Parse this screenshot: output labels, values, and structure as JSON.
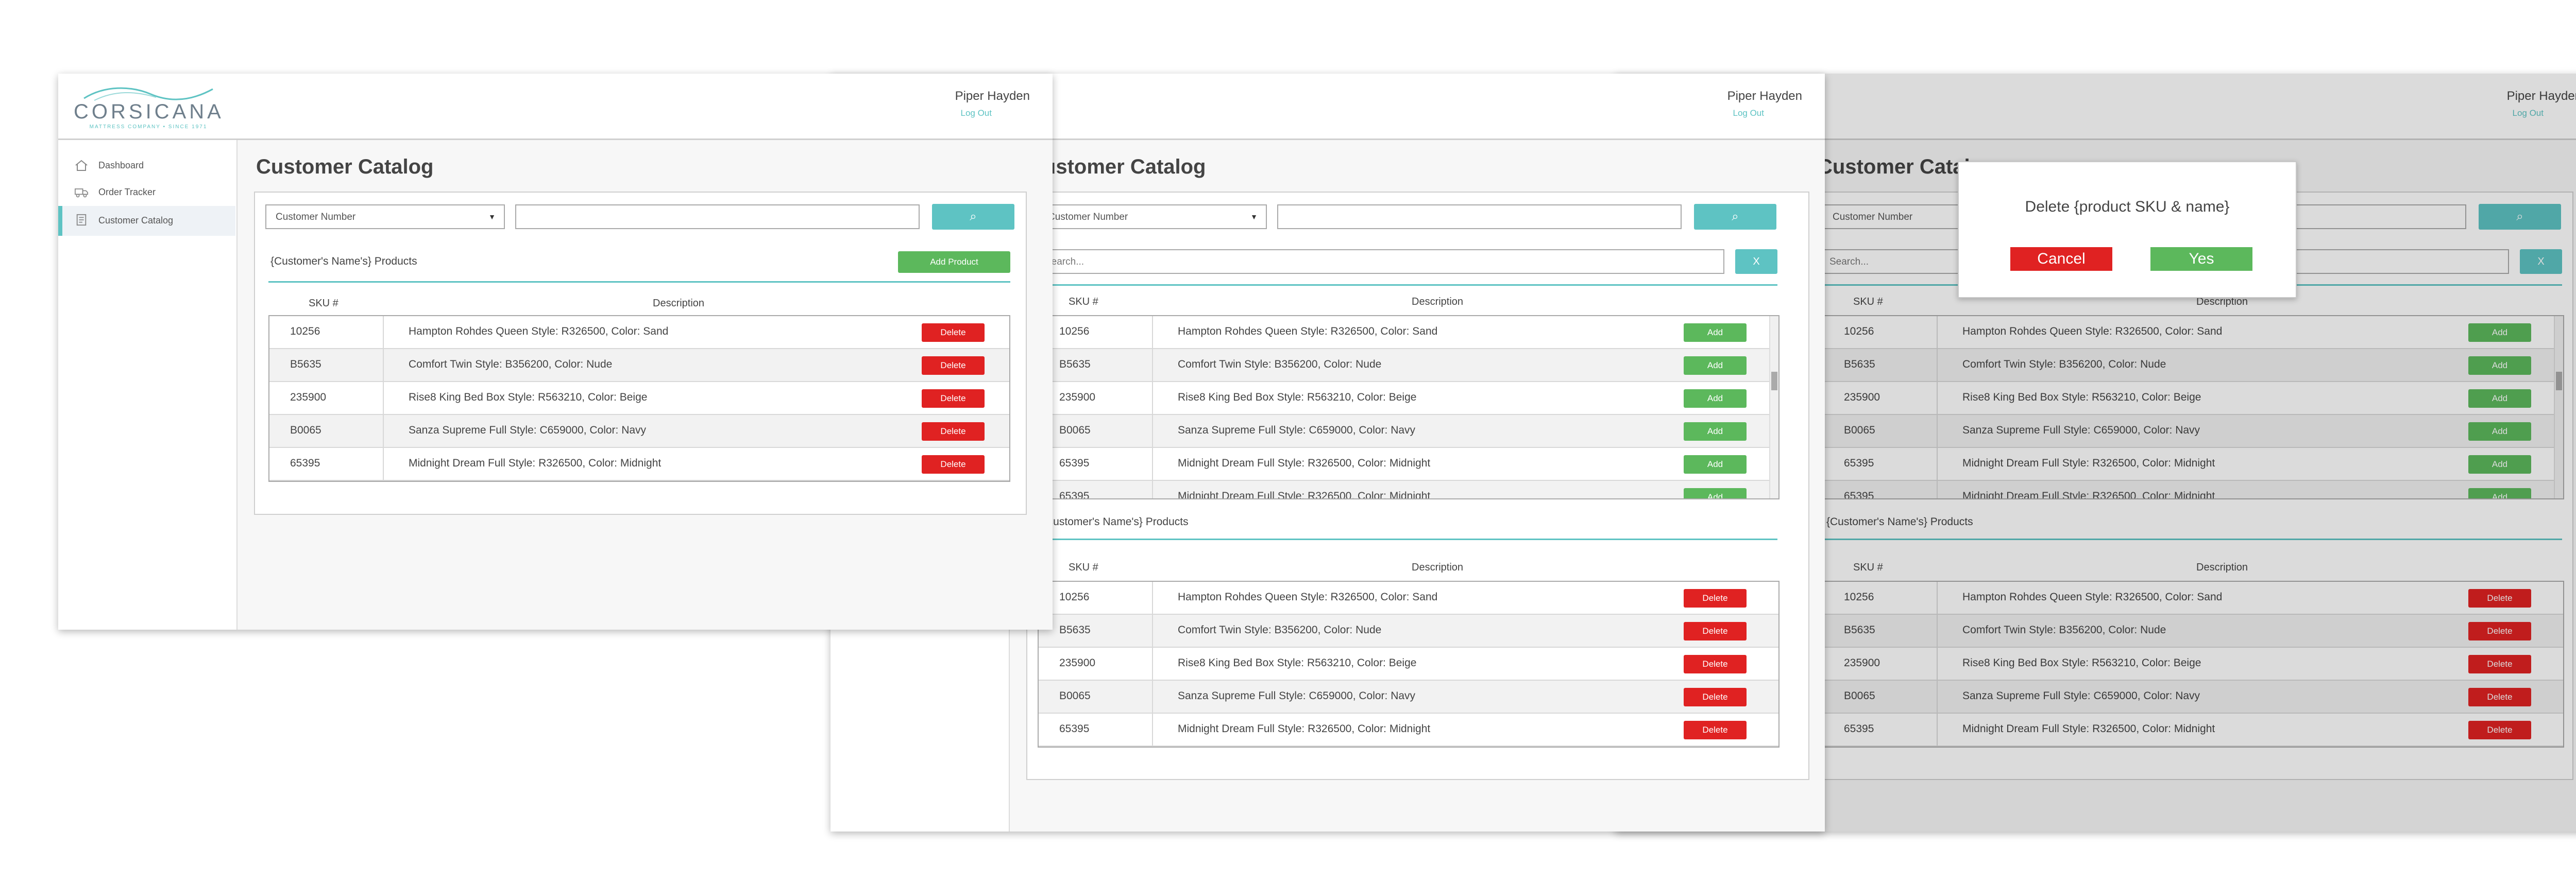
{
  "brand": {
    "name": "CORSICANA",
    "tagline": "MATTRESS COMPANY • SINCE 1971",
    "accent": "#5ec3c3",
    "danger": "#e02222",
    "success": "#5cb85c"
  },
  "header": {
    "user_name": "Piper Hayden",
    "logout": "Log Out"
  },
  "sidebar": {
    "items": [
      {
        "label": "Dashboard",
        "icon": "home-icon"
      },
      {
        "label": "Order Tracker",
        "icon": "truck-icon"
      },
      {
        "label": "Customer Catalog",
        "icon": "document-icon",
        "active": true
      }
    ]
  },
  "page": {
    "title": "Customer Catalog"
  },
  "search": {
    "select_value": "Customer Number",
    "button_icon": "search-icon"
  },
  "products_panel": {
    "title": "{Customer's Name's} Products",
    "add_product_label": "Add Product",
    "col_sku": "SKU #",
    "col_desc": "Description"
  },
  "add_panel": {
    "search_placeholder": "Search...",
    "clear_label": "X",
    "add_label": "Add"
  },
  "delete_label": "Delete",
  "products": [
    {
      "sku": "10256",
      "desc": "Hampton Rohdes Queen  Style: R326500, Color: Sand"
    },
    {
      "sku": "B5635",
      "desc": "Comfort Twin  Style: B356200, Color: Nude"
    },
    {
      "sku": "235900",
      "desc": "Rise8 King Bed Box  Style: R563210, Color: Beige"
    },
    {
      "sku": "B0065",
      "desc": "Sanza Supreme Full  Style: C659000, Color: Navy"
    },
    {
      "sku": "65395",
      "desc": "Midnight Dream Full  Style: R326500, Color: Midnight"
    },
    {
      "sku": "65395",
      "desc": "Midnight Dream Full  Style: R326500, Color: Midnight"
    }
  ],
  "modal": {
    "title": "Delete {product SKU & name}",
    "cancel": "Cancel",
    "yes": "Yes"
  }
}
